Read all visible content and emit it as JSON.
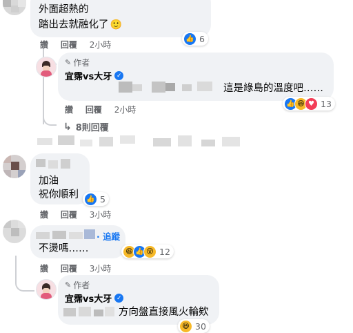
{
  "comment1": {
    "line1": "外面超熱的",
    "line2": "踏出去就融化了",
    "emoji": "🙂",
    "like": "讚",
    "reply": "回覆",
    "time": "2小時",
    "reaction_count": "6"
  },
  "reply1": {
    "author_tag": "作者",
    "name": "宜霈vs大牙",
    "text": "這是綠島的溫度吧……",
    "like": "讚",
    "reply": "回覆",
    "time": "2小時",
    "reaction_count": "13"
  },
  "more_replies": "8則回覆",
  "comment2": {
    "line1": "加油",
    "line2": "祝你順利",
    "like": "讚",
    "reply": "回覆",
    "time": "3小時",
    "reaction_count": "5"
  },
  "comment3": {
    "follow": "· 追蹤",
    "text": "不燙嗎……",
    "like": "讚",
    "reply": "回覆",
    "time": "3小時",
    "reaction_count": "12"
  },
  "reply2": {
    "author_tag": "作者",
    "name": "宜霈vs大牙",
    "text": "方向盤直接風火輪欸",
    "reaction_count": "30"
  },
  "colors": {
    "accent": "#1877f2",
    "bubble": "#f0f2f5",
    "meta": "#65676b"
  },
  "icons": [
    "pencil-icon",
    "verified-badge-icon",
    "reply-arrow-icon",
    "like-reaction-icon",
    "haha-reaction-icon",
    "love-reaction-icon",
    "wow-reaction-icon"
  ]
}
